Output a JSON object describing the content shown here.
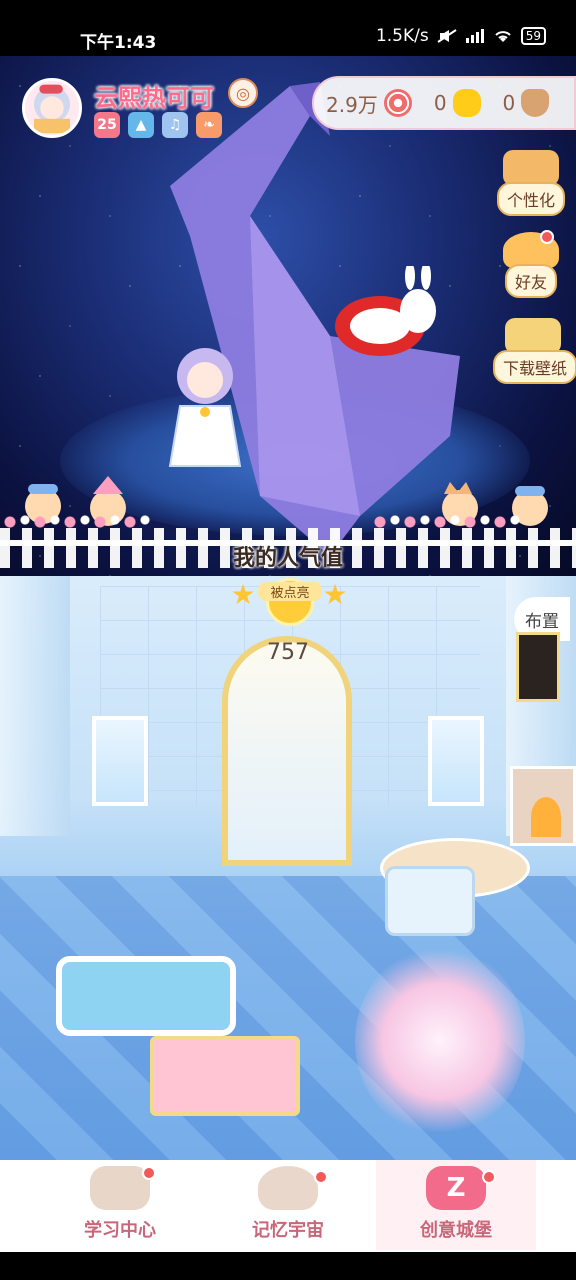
{
  "status_bar": {
    "time": "下午1:43",
    "network_speed": "1.5K/s",
    "battery": "59"
  },
  "user": {
    "name": "云熙热可可",
    "level_badge": "25",
    "currency": [
      {
        "amount": "2.9万",
        "icon": "lollipop-icon",
        "color": "#f26b6b"
      },
      {
        "amount": "0",
        "icon": "gold-nugget-icon",
        "color": "#ffcc1a"
      },
      {
        "amount": "0",
        "icon": "basket-icon",
        "color": "#b07a4a"
      }
    ]
  },
  "side_buttons": {
    "personalize": "个性化",
    "friends": "好友",
    "download_wallpaper": "下载壁纸"
  },
  "popularity": {
    "title": "我的人气值",
    "badge_caption": "被点亮",
    "count": "757"
  },
  "room": {
    "layout_button": "布置"
  },
  "bottom_nav": [
    {
      "label": "学习中心",
      "icon": "study-center-icon"
    },
    {
      "label": "记忆宇宙",
      "icon": "memory-universe-icon"
    },
    {
      "label": "创意城堡",
      "icon": "creative-castle-icon"
    }
  ]
}
